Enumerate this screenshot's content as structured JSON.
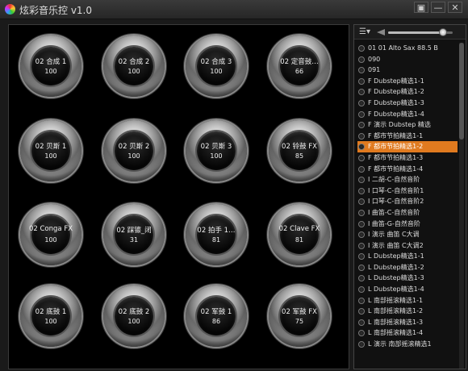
{
  "window": {
    "title": "炫彩音乐控 v1.0",
    "controls": [
      "▣",
      "—",
      "✕"
    ]
  },
  "pads": [
    {
      "name": "02 合成 1",
      "value": "100"
    },
    {
      "name": "02 合成 2",
      "value": "100"
    },
    {
      "name": "02 合成 3",
      "value": "100"
    },
    {
      "name": "02 定音鼓…",
      "value": "66"
    },
    {
      "name": "02 贝斯 1",
      "value": "100"
    },
    {
      "name": "02 贝斯 2",
      "value": "100"
    },
    {
      "name": "02 贝斯 3",
      "value": "100"
    },
    {
      "name": "02 铃鼓 FX",
      "value": "85"
    },
    {
      "name": "02 Conga FX",
      "value": "100"
    },
    {
      "name": "02 踩镲_闭",
      "value": "31"
    },
    {
      "name": "02 拍手 1…",
      "value": "81"
    },
    {
      "name": "02 Clave FX",
      "value": "81"
    },
    {
      "name": "02 底鼓 1",
      "value": "100"
    },
    {
      "name": "02 底鼓 2",
      "value": "100"
    },
    {
      "name": "02 军鼓 1",
      "value": "86"
    },
    {
      "name": "02 军鼓 FX",
      "value": "75"
    }
  ],
  "playlist": {
    "menu_label": "☰▾",
    "volume": 0.85,
    "selected_index": 9,
    "items": [
      "01 01 Alto Sax 88.5 B",
      "090",
      "091",
      "F Dubstep精选1-1",
      "F Dubstep精选1-2",
      "F Dubstep精选1-3",
      "F Dubstep精选1-4",
      "F 演示 Dubstep 精选",
      "F 都市节拍精选1-1",
      "F 都市节拍精选1-2",
      "F 都市节拍精选1-3",
      "F 都市节拍精选1-4",
      "I 二胡-C-自然音阶",
      "I 口琴-C-自然音阶1",
      "I 口琴-C-自然音阶2",
      "I 曲笛-C-自然音阶",
      "I 曲笛-G-自然音阶",
      "I 演示 曲笛 C大调",
      "I 演示 曲笛 C大调2",
      "L Dubstep精选1-1",
      "L Dubstep精选1-2",
      "L Dubstep精选1-3",
      "L Dubstep精选1-4",
      "L 南部摇滚精选1-1",
      "L 南部摇滚精选1-2",
      "L 南部摇滚精选1-3",
      "L 南部摇滚精选1-4",
      "L 演示 南部摇滚精选1"
    ]
  }
}
